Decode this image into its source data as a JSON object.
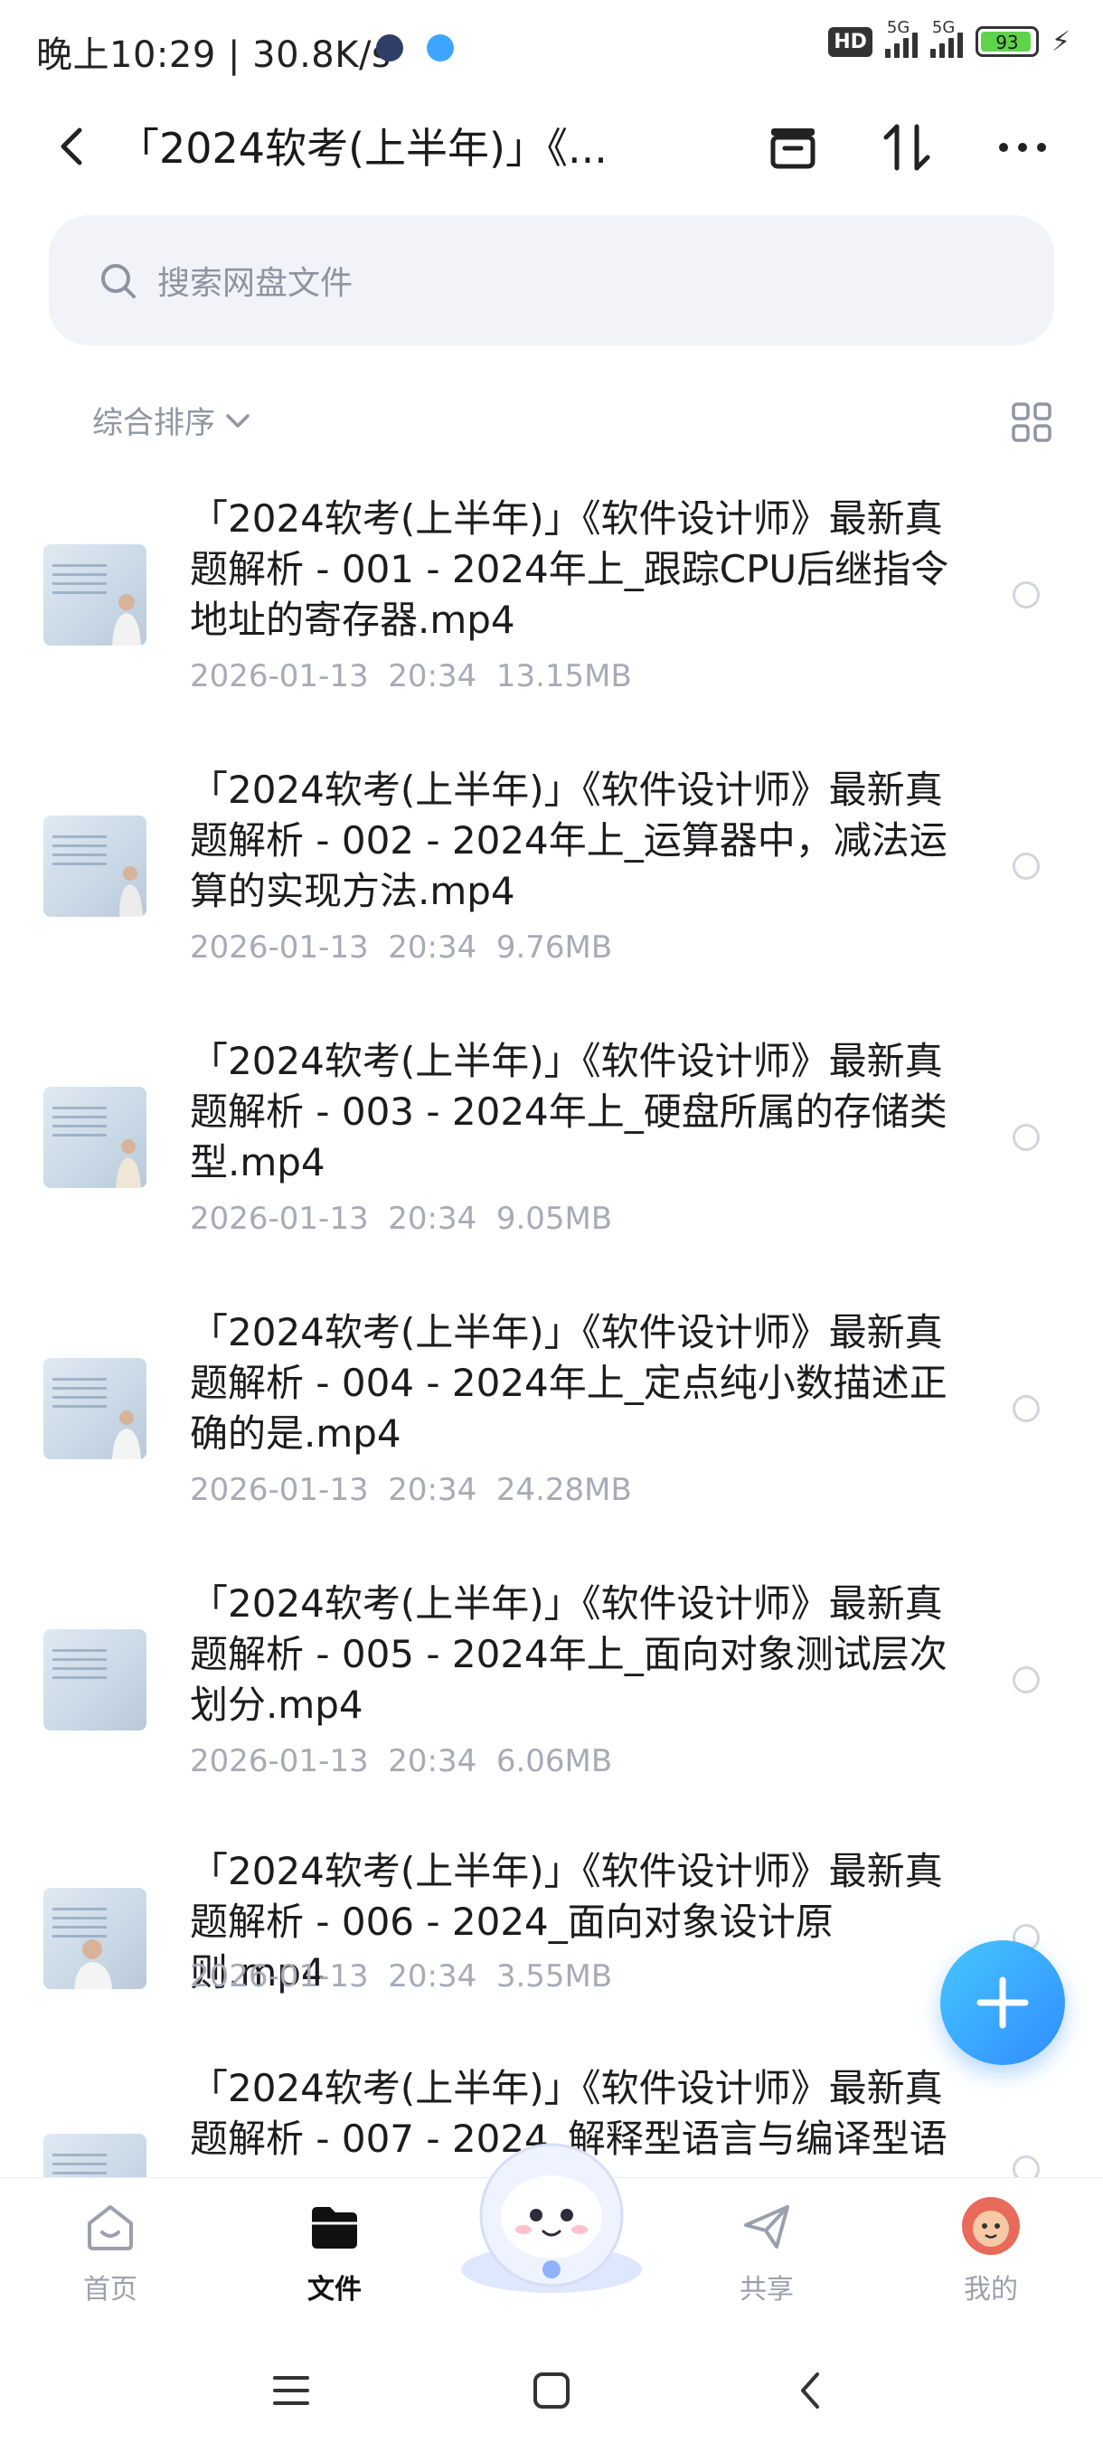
{
  "status_bar": {
    "time": "晚上10:29 | 30.8K/s",
    "hd_label": "HD",
    "network_1": "5G",
    "network_2": "5G",
    "battery": "93"
  },
  "header": {
    "title": "「2024软考(上半年)」《...",
    "icons": [
      "back-icon",
      "archive-icon",
      "sort-updown-icon",
      "more-icon"
    ]
  },
  "search": {
    "placeholder": "搜索网盘文件"
  },
  "sort": {
    "label": "综合排序"
  },
  "files": [
    {
      "name": "「2024软考(上半年)」《软件设计师》最新真题解析 - 001 - 2024年上_跟踪CPU后继指令地址的寄存器.mp4",
      "date": "2026-01-13",
      "time": "20:34",
      "size": "13.15MB"
    },
    {
      "name": "「2024软考(上半年)」《软件设计师》最新真题解析 - 002 - 2024年上_运算器中，减法运算的实现方法.mp4",
      "date": "2026-01-13",
      "time": "20:34",
      "size": "9.76MB"
    },
    {
      "name": "「2024软考(上半年)」《软件设计师》最新真题解析 - 003 - 2024年上_硬盘所属的存储类型.mp4",
      "date": "2026-01-13",
      "time": "20:34",
      "size": "9.05MB"
    },
    {
      "name": "「2024软考(上半年)」《软件设计师》最新真题解析 - 004 - 2024年上_定点纯小数描述正确的是.mp4",
      "date": "2026-01-13",
      "time": "20:34",
      "size": "24.28MB"
    },
    {
      "name": "「2024软考(上半年)」《软件设计师》最新真题解析 - 005 - 2024年上_面向对象测试层次划分.mp4",
      "date": "2026-01-13",
      "time": "20:34",
      "size": "6.06MB"
    },
    {
      "name": "「2024软考(上半年)」《软件设计师》最新真题解析 - 006 - 2024_面向对象设计原则.mp4",
      "date": "2026-01-13",
      "time": "20:34",
      "size": "3.55MB"
    },
    {
      "name": "「2024软考(上半年)」《软件设计师》最新真题解析 - 007 - 2024_解释型语言与编译型语",
      "date": "",
      "time": "",
      "size": ""
    }
  ],
  "tabbar": {
    "tabs": [
      {
        "label": "首页",
        "icon": "home-icon"
      },
      {
        "label": "文件",
        "icon": "folder-icon"
      },
      {
        "label": "共享",
        "icon": "share-icon"
      },
      {
        "label": "我的",
        "icon": "avatar-icon"
      }
    ],
    "active": "文件"
  },
  "colors": {
    "accent": "#2f8dff",
    "muted": "#a6abb6",
    "search_bg": "#f1f3f8"
  }
}
